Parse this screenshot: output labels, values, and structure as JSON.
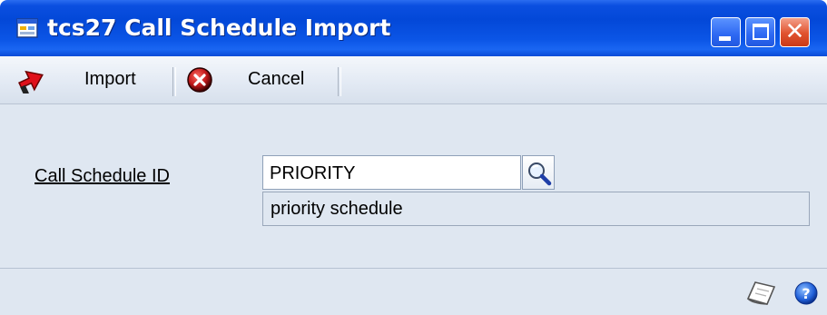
{
  "window": {
    "title": "tcs27 Call Schedule Import"
  },
  "titlebar_buttons": {
    "minimize": "minimize",
    "maximize": "maximize",
    "close": "close"
  },
  "toolbar": {
    "import_label": "Import",
    "cancel_label": "Cancel"
  },
  "form": {
    "call_schedule_id_label": "Call Schedule ID",
    "call_schedule_id_value": "PRIORITY",
    "description": "priority schedule"
  },
  "icons": {
    "app": "window-app-icon",
    "import": "import-arrow-icon",
    "cancel": "cancel-x-icon",
    "lookup": "magnifier-icon",
    "note": "note-icon",
    "help": "help-icon"
  },
  "colors": {
    "titlebar": "#0348d8",
    "content_bg": "#dfe7f1",
    "close_button": "#e0522e",
    "import_icon": "#e0101a",
    "cancel_icon": "#c0181a"
  }
}
